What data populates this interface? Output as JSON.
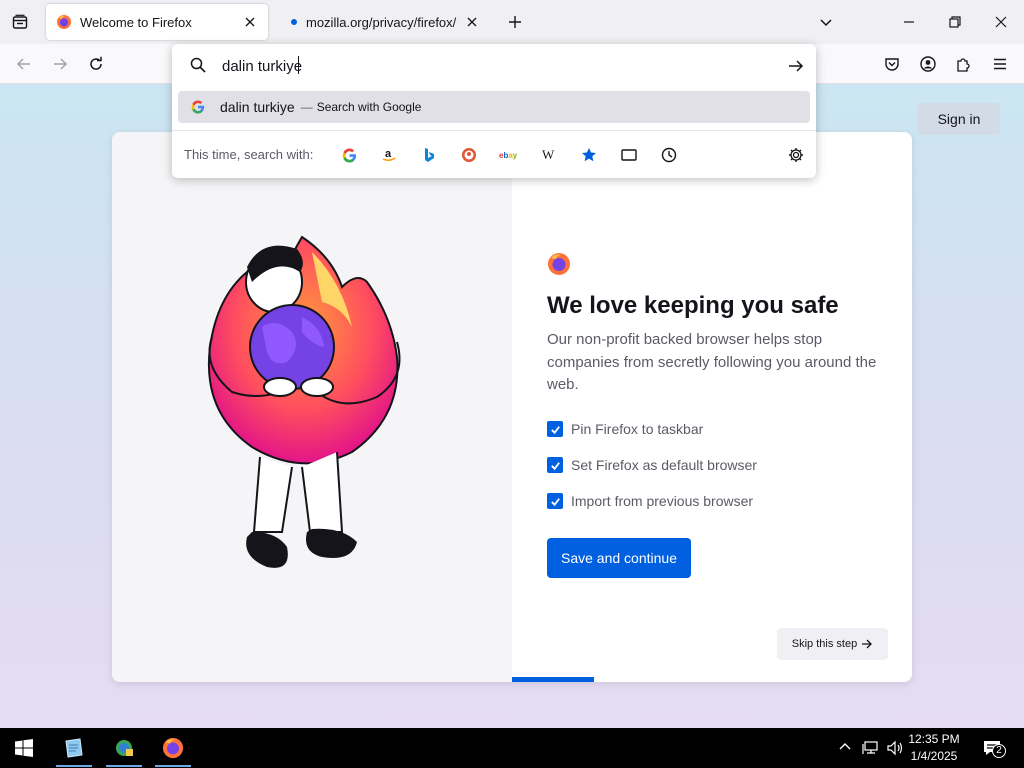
{
  "tabs": [
    {
      "title": "Welcome to Firefox",
      "active": true
    },
    {
      "title": "mozilla.org/privacy/firefox/",
      "active": false
    }
  ],
  "urlbar": {
    "value": "dalin turkiye"
  },
  "suggestion": {
    "query": "dalin turkiye",
    "separator": "—",
    "action": "Search with Google"
  },
  "search_with_label": "This time, search with:",
  "search_engines": [
    "google-icon",
    "amazon-icon",
    "bing-icon",
    "duckduckgo-icon",
    "ebay-icon",
    "wikipedia-icon",
    "bookmarks-icon",
    "tabs-icon",
    "history-icon"
  ],
  "header": {
    "signin": "Sign in"
  },
  "onboarding": {
    "heading": "We love keeping you safe",
    "subtext": "Our non-profit backed browser helps stop companies from secretly following you around the web.",
    "options": [
      {
        "label": "Pin Firefox to taskbar",
        "checked": true
      },
      {
        "label": "Set Firefox as default browser",
        "checked": true
      },
      {
        "label": "Import from previous browser",
        "checked": true
      }
    ],
    "primary_button": "Save and continue",
    "skip_button": "Skip this step"
  },
  "taskbar": {
    "time": "12:35 PM",
    "date": "1/4/2025",
    "notifications": "2"
  },
  "colors": {
    "accent": "#0060df",
    "tabbar": "#f0f0f4",
    "taskbar": "#000000"
  }
}
